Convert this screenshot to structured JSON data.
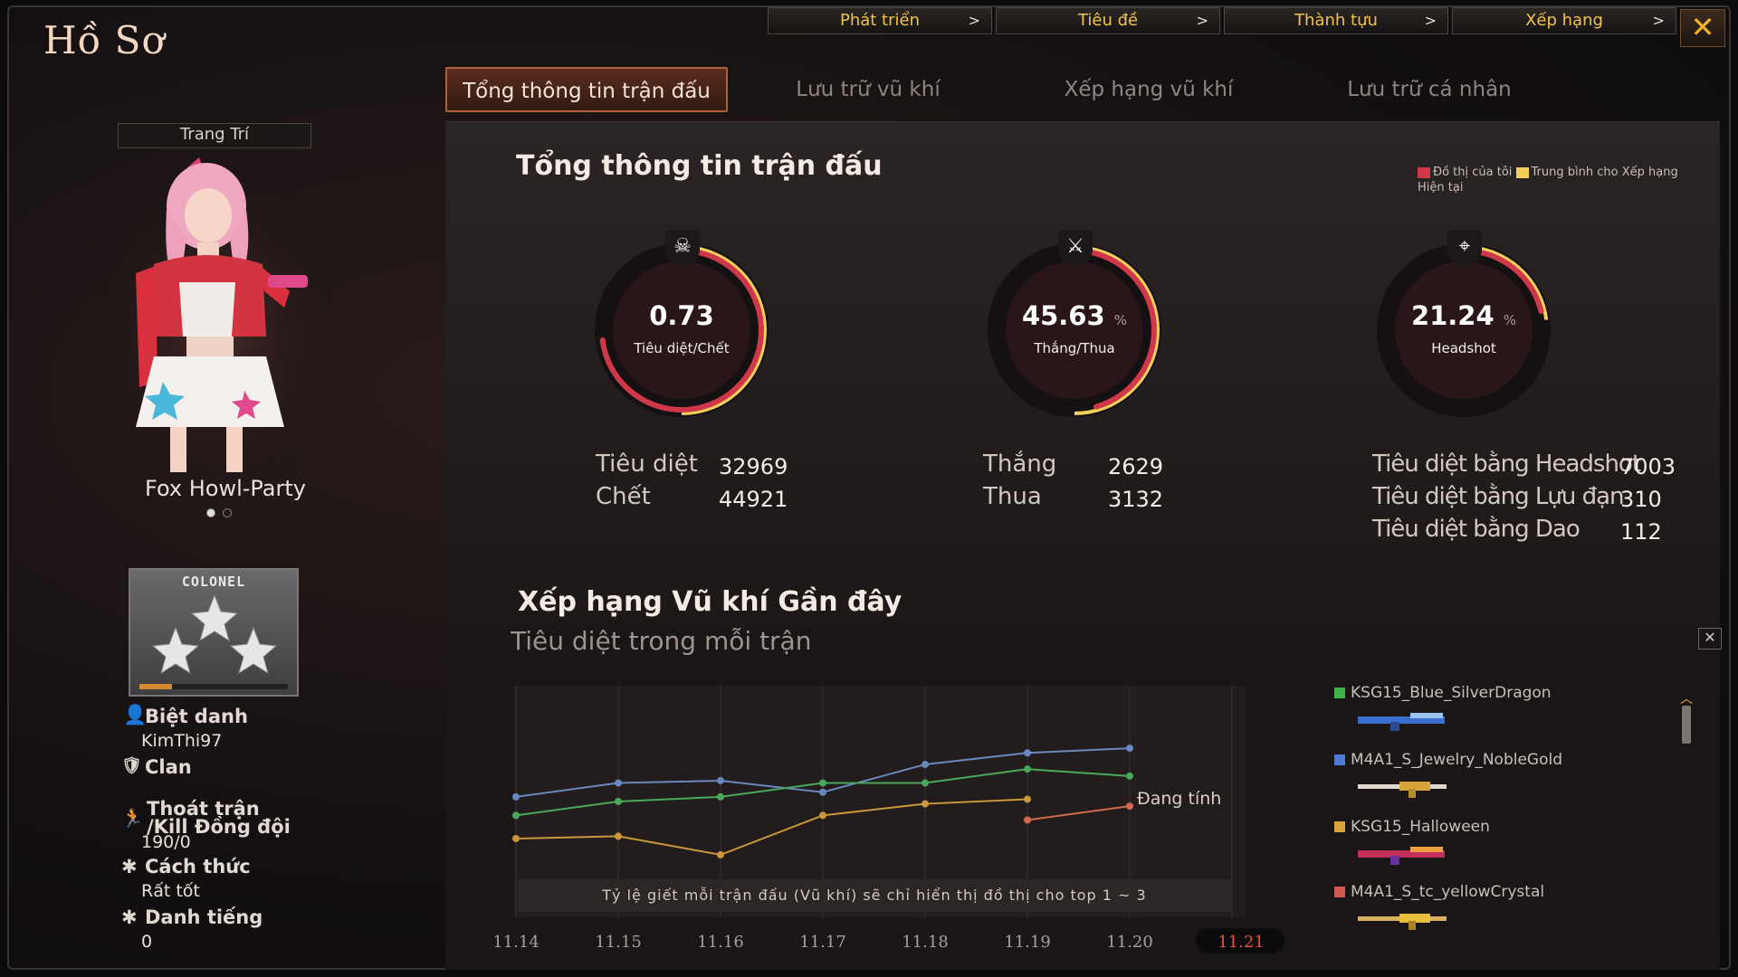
{
  "title": "Hồ Sơ",
  "top_nav": [
    {
      "label": "Phát triển"
    },
    {
      "label": "Tiêu đề"
    },
    {
      "label": "Thành tựu"
    },
    {
      "label": "Xếp hạng"
    }
  ],
  "nav_arrow": ">",
  "close_glyph": "✕",
  "tabs": [
    {
      "label": "Tổng thông tin trận đấu"
    },
    {
      "label": "Lưu trữ vũ khí"
    },
    {
      "label": "Xếp hạng vũ khí"
    },
    {
      "label": "Lưu trữ cá nhân"
    }
  ],
  "left": {
    "decor_label": "Trang Trí",
    "character_name": "Fox Howl-Party",
    "rank_name": "COLONEL",
    "nickname_label": "Biệt danh",
    "nickname_value": "KimThi97",
    "clan_label": "Clan",
    "quit_label_1": "Thoát trận",
    "quit_label_2": "/Kill Đồng đội",
    "quit_value": "190/0",
    "style_label": "Cách thức",
    "style_value": "Rất tốt",
    "fame_label": "Danh tiếng",
    "fame_value": "0"
  },
  "overview": {
    "title": "Tổng thông tin trận đấu",
    "legend_mine": "Đồ thị của tôi",
    "legend_avg": "Trung bình cho Xếp hạng Hiện tại",
    "legend_mine_color": "#d0384a",
    "legend_avg_color": "#f2d05a",
    "gauges": [
      {
        "value": "0.73",
        "unit": "",
        "label": "Tiêu diệt/Chết",
        "badge": "☠",
        "my_fraction": 0.73,
        "avg_fraction": 0.5
      },
      {
        "value": "45.63",
        "unit": "%",
        "label": "Thắng/Thua",
        "badge": "⚔",
        "my_fraction": 0.456,
        "avg_fraction": 0.5
      },
      {
        "value": "21.24",
        "unit": "%",
        "label": "Headshot",
        "badge": "⌖",
        "my_fraction": 0.212,
        "avg_fraction": 0.23
      }
    ],
    "stats": {
      "kills_label": "Tiêu diệt",
      "kills_value": "32969",
      "deaths_label": "Chết",
      "deaths_value": "44921",
      "wins_label": "Thắng",
      "wins_value": "2629",
      "losses_label": "Thua",
      "losses_value": "3132",
      "hs_label": "Tiêu diệt bằng Headshot",
      "hs_value": "7003",
      "grenade_label": "Tiêu diệt bằng Lựu đạn",
      "grenade_value": "310",
      "knife_label": "Tiêu diệt bằng Dao",
      "knife_value": "112"
    }
  },
  "weapon_rank": {
    "title": "Xếp hạng Vũ khí Gần đây",
    "subtitle": "Tiêu diệt trong mỗi trận",
    "calculating": "Đang tính",
    "note": "Tỷ lệ giết mỗi trận đấu (Vũ khí) sẽ chỉ hiển thị đồ thị cho top 1 ~ 3",
    "close_glyph": "✕",
    "weapons": [
      {
        "name": "KSG15_Blue_SilverDragon",
        "color": "#3fb24a"
      },
      {
        "name": "M4A1_S_Jewelry_NobleGold",
        "color": "#4d7ad0"
      },
      {
        "name": "KSG15_Halloween",
        "color": "#d6a43a"
      },
      {
        "name": "M4A1_S_tc_yellowCrystal",
        "color": "#d05a50"
      }
    ]
  },
  "chart_data": {
    "type": "line",
    "categories": [
      "11.14",
      "11.15",
      "11.16",
      "11.17",
      "11.18",
      "11.19",
      "11.20",
      "11.21"
    ],
    "selected_category": "11.21",
    "ylim": [
      0,
      10
    ],
    "series": [
      {
        "color": "#6a88c0",
        "values": [
          5.2,
          5.8,
          5.9,
          5.4,
          6.6,
          7.1,
          7.3,
          null
        ]
      },
      {
        "color": "#4aa85a",
        "values": [
          4.4,
          5.0,
          5.2,
          5.8,
          5.8,
          6.4,
          6.1,
          null
        ]
      },
      {
        "color": "#c9983a",
        "values": [
          3.4,
          3.5,
          2.7,
          4.4,
          4.9,
          5.1,
          null,
          null
        ]
      },
      {
        "color": "#d06a4a",
        "values": [
          null,
          null,
          null,
          null,
          null,
          4.2,
          4.8,
          null
        ]
      }
    ]
  }
}
